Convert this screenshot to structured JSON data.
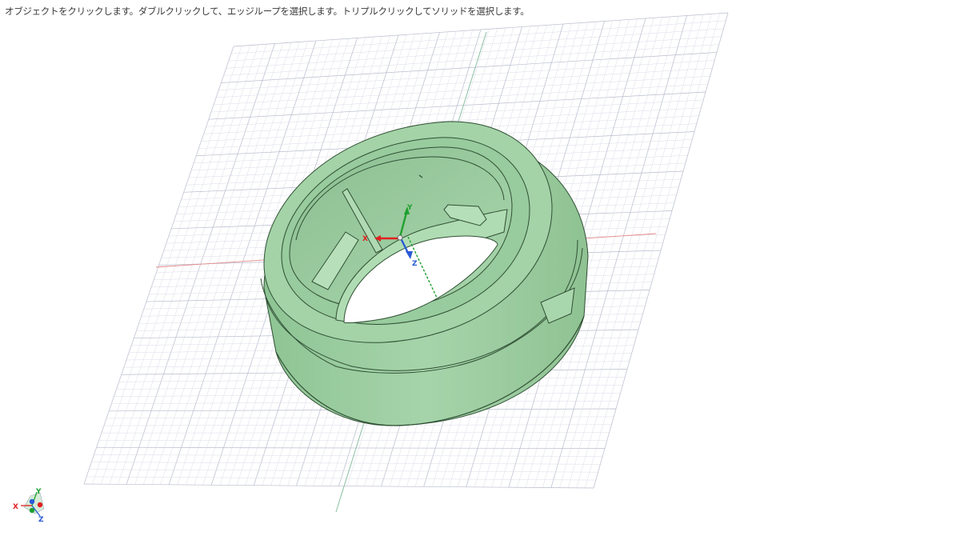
{
  "status": {
    "hint_text": "オブジェクトをクリックします。ダブルクリックして、エッジループを選択します。トリプルクリックしてソリッドを選択します。"
  },
  "colors": {
    "background": "#ffffff",
    "grid_minor": "#d6d8e4",
    "grid_major": "#b8bccd",
    "axis_x": "#e58a8a",
    "axis_y": "#7fb89a",
    "model_face": "#9fcfa4",
    "model_face_dark": "#83b888",
    "model_edge": "#2f4f33",
    "gizmo_x": "#e02020",
    "gizmo_y": "#1fa02f",
    "gizmo_z": "#2a5bd6"
  },
  "gizmo": {
    "x_label": "X",
    "y_label": "Y",
    "z_label": "Z"
  },
  "view_triad": {
    "x_label": "X",
    "y_label": "Y",
    "z_label": "Z",
    "icon": "view-cube-triad-icon"
  }
}
